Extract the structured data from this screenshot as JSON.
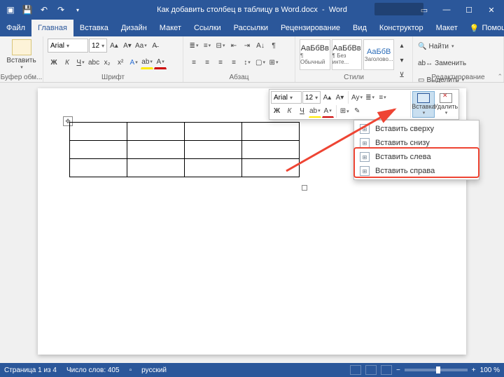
{
  "app": {
    "doc_title": "Как добавить столбец в таблицу в Word.docx",
    "app_name": "Word"
  },
  "tabs": {
    "file": "Файл",
    "home": "Главная",
    "insert": "Вставка",
    "design": "Дизайн",
    "layout": "Макет",
    "references": "Ссылки",
    "mailings": "Рассылки",
    "review": "Рецензирование",
    "view": "Вид",
    "designer": "Конструктор",
    "layout2": "Макет",
    "help": "Помощ"
  },
  "ribbon": {
    "clipboard": {
      "label": "Буфер обм...",
      "paste": "Вставить"
    },
    "font": {
      "label": "Шрифт",
      "family": "Arial",
      "size": "12",
      "bold": "Ж",
      "italic": "К",
      "underline": "Ч",
      "strike": "abc",
      "sub": "x₂",
      "sup": "x²"
    },
    "paragraph": {
      "label": "Абзац"
    },
    "styles": {
      "label": "Стили",
      "s1": {
        "sample": "АаБбВв",
        "name": "¶ Обычный"
      },
      "s2": {
        "sample": "АаБбВв",
        "name": "¶ Без инте..."
      },
      "s3": {
        "sample": "АаБбВ",
        "name": "Заголово..."
      }
    },
    "editing": {
      "label": "Редактирование",
      "find": "Найти",
      "replace": "Заменить",
      "select": "Выделить"
    }
  },
  "minitoolbar": {
    "font": "Arial",
    "size": "12",
    "bold": "Ж",
    "italic": "К",
    "underline": "Ч",
    "insert": "Вставка",
    "delete": "Удалить"
  },
  "menu": {
    "insert_above": "Вставить сверху",
    "insert_below": "Вставить снизу",
    "insert_left": "Вставить слева",
    "insert_right": "Вставить справа"
  },
  "status": {
    "page": "Страница 1 из 4",
    "words": "Число слов: 405",
    "lang": "русский",
    "zoom": "100 %"
  }
}
